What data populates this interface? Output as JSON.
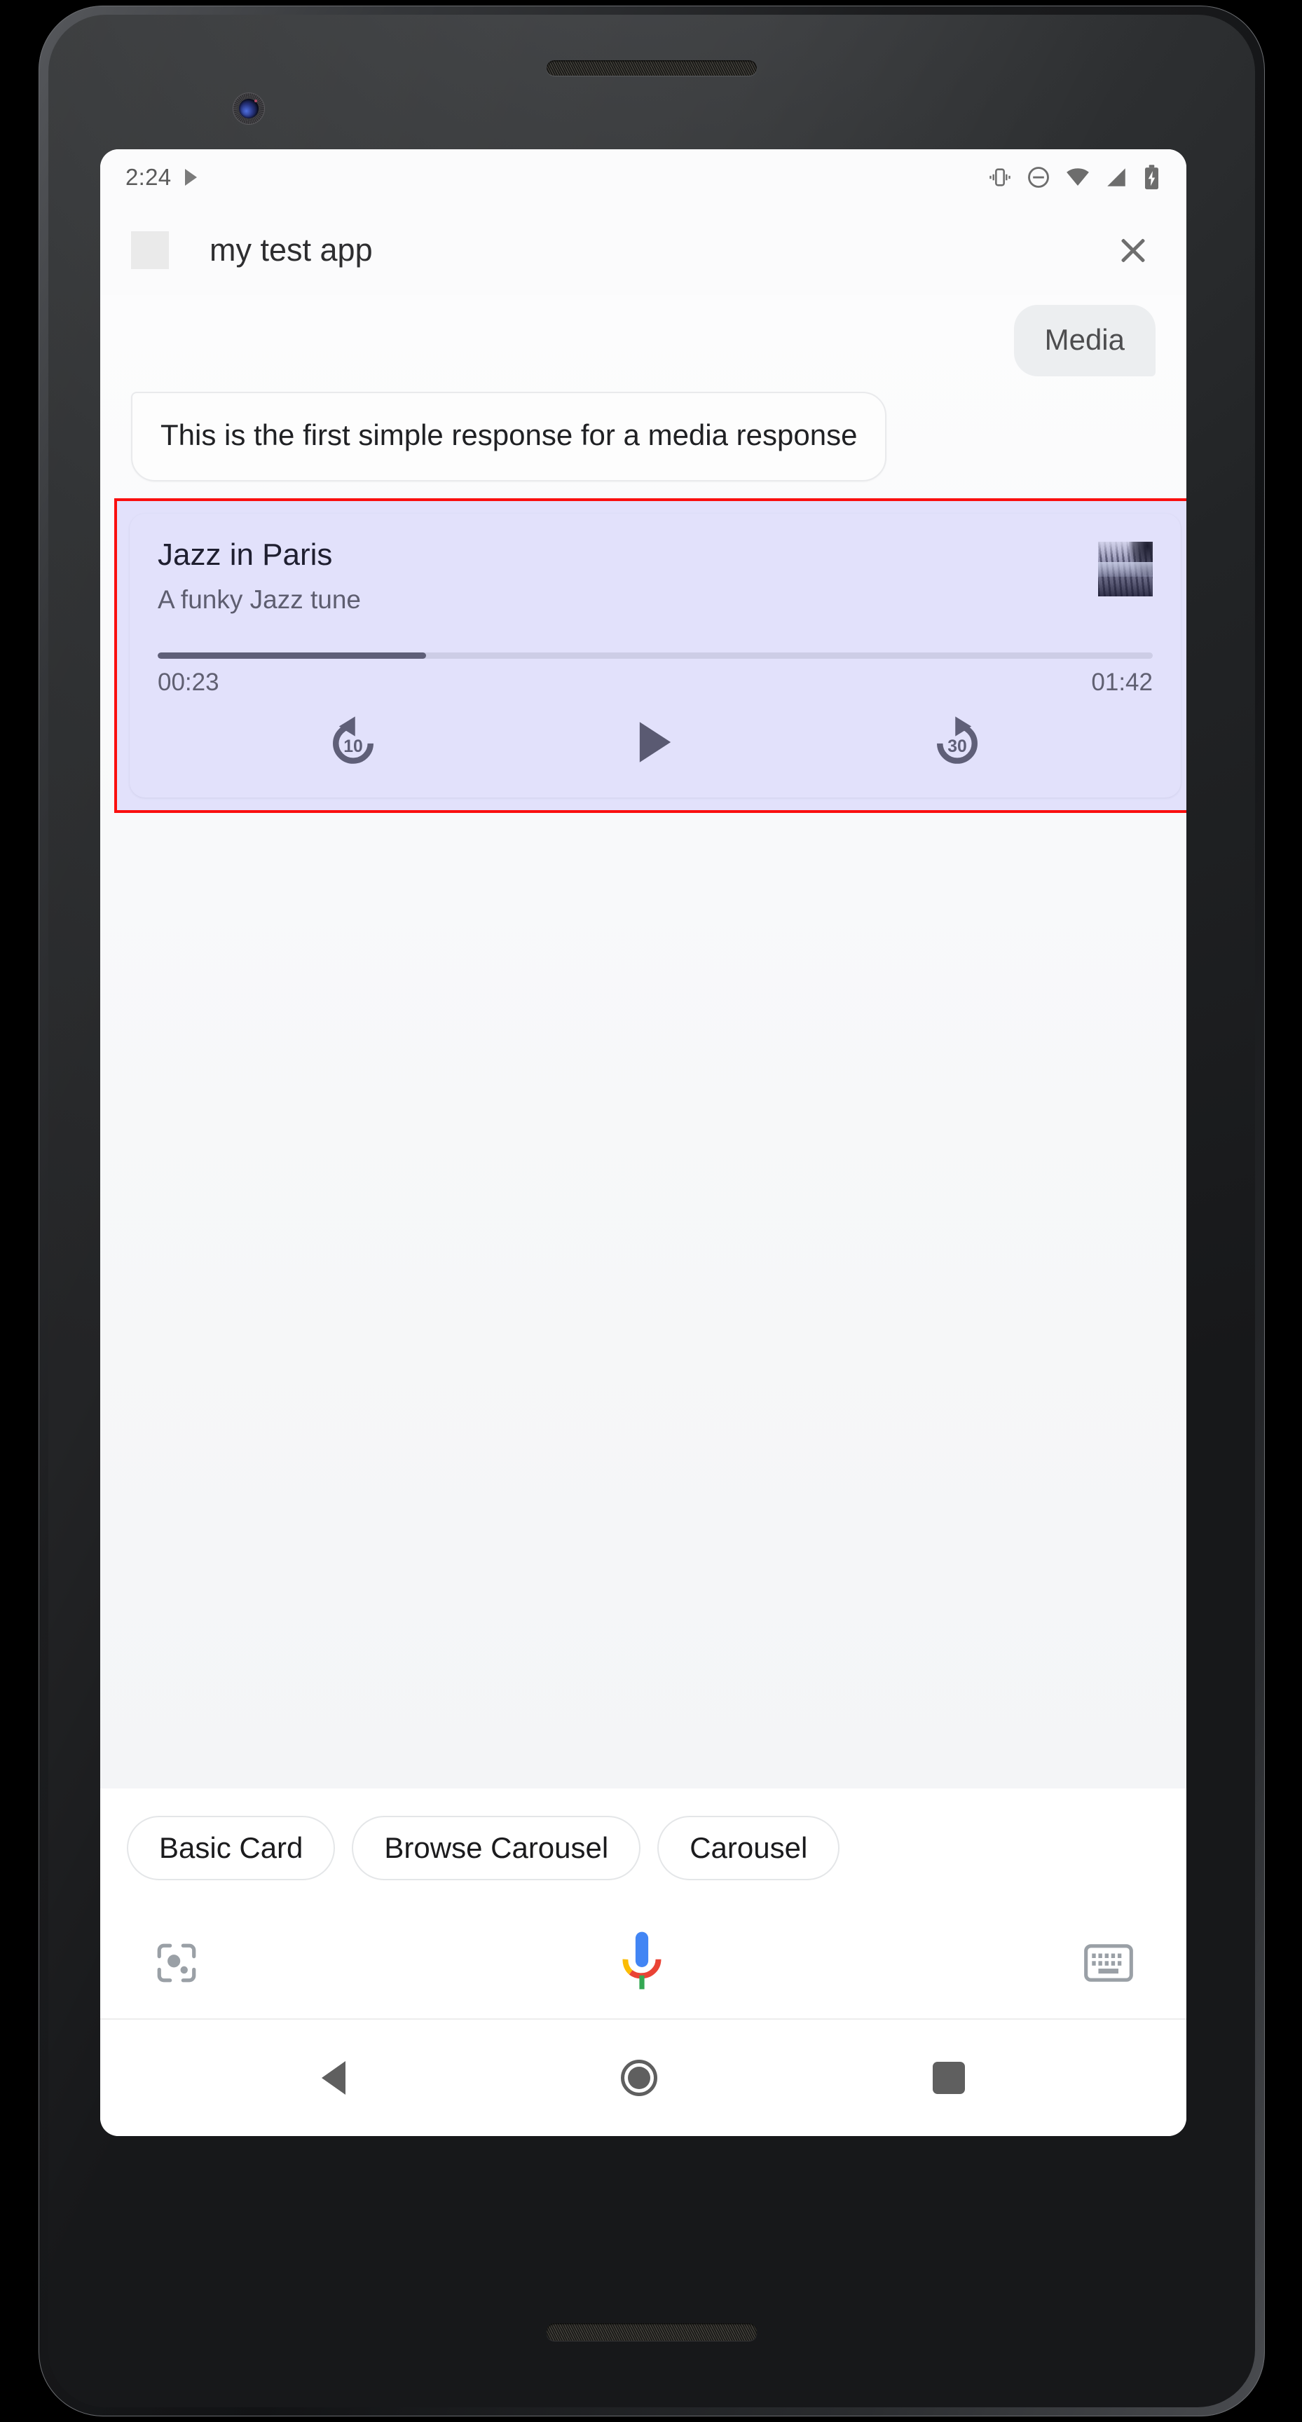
{
  "status_bar": {
    "time": "2:24",
    "left_icons": [
      "play-arrow-icon"
    ],
    "right_icons": [
      "vibrate-icon",
      "do-not-disturb-icon",
      "wifi-icon",
      "cell-signal-icon",
      "battery-charging-icon"
    ]
  },
  "header": {
    "app_icon": "app-placeholder-icon",
    "title": "my test app",
    "close_icon": "close-icon"
  },
  "conversation": {
    "user_message": "Media",
    "agent_message": "This is the first simple response for a media response"
  },
  "media_card": {
    "highlighted": true,
    "highlight_color": "#fa0f0f",
    "card_background": "#e2e1fb",
    "title": "Jazz in Paris",
    "subtitle": "A funky Jazz tune",
    "thumbnail": "album-art-image",
    "progress": {
      "current_time": "00:23",
      "total_time": "01:42",
      "percent": 27,
      "fill_color": "#5f5f78",
      "track_color": "#cdcde6"
    },
    "controls": [
      {
        "name": "replay-10-icon",
        "label": "10"
      },
      {
        "name": "play-icon",
        "label": ""
      },
      {
        "name": "forward-30-icon",
        "label": "30"
      }
    ]
  },
  "suggestion_chips": [
    {
      "label": "Basic Card"
    },
    {
      "label": "Browse Carousel"
    },
    {
      "label": "Carousel"
    }
  ],
  "assistant_bar": {
    "lens_icon": "google-lens-icon",
    "mic_icon": "assistant-mic-icon",
    "keyboard_icon": "keyboard-icon",
    "mic_colors": {
      "blue": "#4285F4",
      "red": "#EA4335",
      "yellow": "#FBBC05",
      "green": "#34A853"
    }
  },
  "nav_bar": {
    "back": "back-triangle-icon",
    "home": "home-circle-icon",
    "recents": "recents-square-icon"
  }
}
